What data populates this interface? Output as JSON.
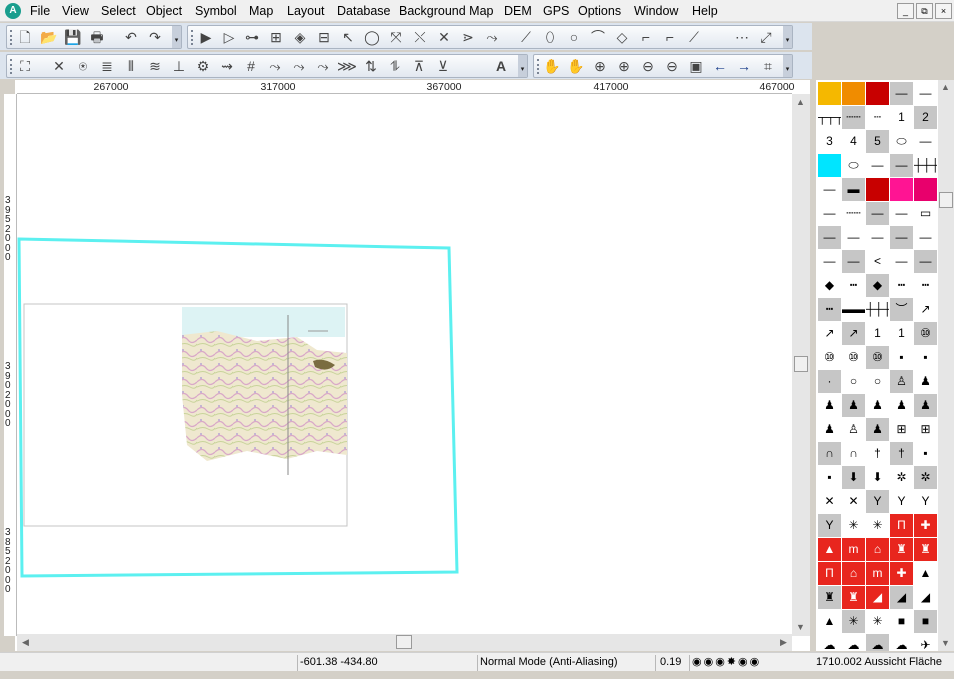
{
  "app": {
    "icon_letter": "A"
  },
  "menu": [
    "File",
    "View",
    "Select",
    "Object",
    "Symbol",
    "Map",
    "Layout",
    "Database",
    "Background Map",
    "DEM",
    "GPS",
    "Options",
    "Window",
    "Help"
  ],
  "window_controls": [
    "_",
    "⧉",
    "×"
  ],
  "toolbar1": [
    "🗋",
    "📂",
    "💾",
    "🖶",
    "↶",
    "↷",
    "▶",
    "▷",
    "⊶",
    "⊞",
    "◈",
    "⊟",
    "↖",
    "◯",
    "⤧",
    "⤬",
    "✕",
    "⋗",
    "⤳",
    "⟋",
    "⬯",
    "○",
    "⌒",
    "◇",
    "⌐",
    "⌐",
    "⟋",
    "⋯",
    "⤢"
  ],
  "toolbar2": [
    "⛶",
    "✕",
    "⍟",
    "≣",
    "⦀",
    "≋",
    "⊥",
    "⚙",
    "⇝",
    "#",
    "⤳",
    "⤳",
    "⤳",
    "⋙",
    "⇅",
    "⥮",
    "⊼",
    "⊻",
    "A",
    "✋",
    "✋",
    "⊕",
    "⊕",
    "⊖",
    "⊖",
    "▣",
    "←",
    "→",
    "⌗"
  ],
  "ruler": {
    "h": [
      "267000",
      "317000",
      "367000",
      "417000",
      "467000"
    ],
    "v": [
      "3952000",
      "3902000",
      "3852000"
    ]
  },
  "symbols": [
    "▮",
    "▮",
    "▮",
    "—",
    "—",
    "┬┬┬┬",
    "┄┄",
    "┄",
    "1",
    "2",
    "3",
    "4",
    "5",
    "⬭",
    "—",
    "▮",
    "⬭",
    "—",
    "—",
    "┼┼┼",
    "—",
    "▬",
    "▮",
    "▮",
    "▮",
    "—",
    "┄┄",
    "—",
    "—",
    "▭",
    "—",
    "—",
    "—",
    "—",
    "—",
    "—",
    "—",
    "<",
    "—",
    "—",
    "◆",
    "┅",
    "◆",
    "┅",
    "┅",
    "┅",
    "▬▬",
    "┼┼┼",
    "︶",
    "↗",
    "↗",
    "↗",
    "1",
    "1",
    "⑩",
    "⑩",
    "⑩",
    "⑩",
    "▪",
    "▪",
    "·",
    "○",
    "○",
    "♙",
    "♟",
    "♟",
    "♟",
    "♟",
    "♟",
    "♟",
    "♟",
    "♙",
    "♟",
    "⊞",
    "⊞",
    "∩",
    "∩",
    "†",
    "†",
    "▪",
    "▪",
    "⬇",
    "⬇",
    "✲",
    "✲",
    "✕",
    "✕",
    "Y",
    "Y",
    "Y",
    "Y",
    "✳",
    "✳",
    "Π",
    "✚",
    "▲",
    "m",
    "⌂",
    "♜",
    "♜",
    "Π",
    "⌂",
    "m",
    "✚",
    "▲",
    "♜",
    "♜",
    "◢",
    "◢",
    "◢",
    "▲",
    "✳",
    "✳",
    "■",
    "■",
    "☁",
    "☁",
    "☁",
    "☁",
    "✈",
    "∿",
    "▭",
    "▭",
    "▭",
    "▪"
  ],
  "status": {
    "coords": "-601.38   -434.80",
    "mode": "Normal Mode (Anti-Aliasing)",
    "zoom": "0.19",
    "view": "1710.002 Aussicht Fläche"
  },
  "colors": {
    "selection": "#5cf0f0",
    "orange": "#f5b800",
    "red": "#c80000",
    "magenta": "#ff1493",
    "cyan": "#00e5ff"
  }
}
